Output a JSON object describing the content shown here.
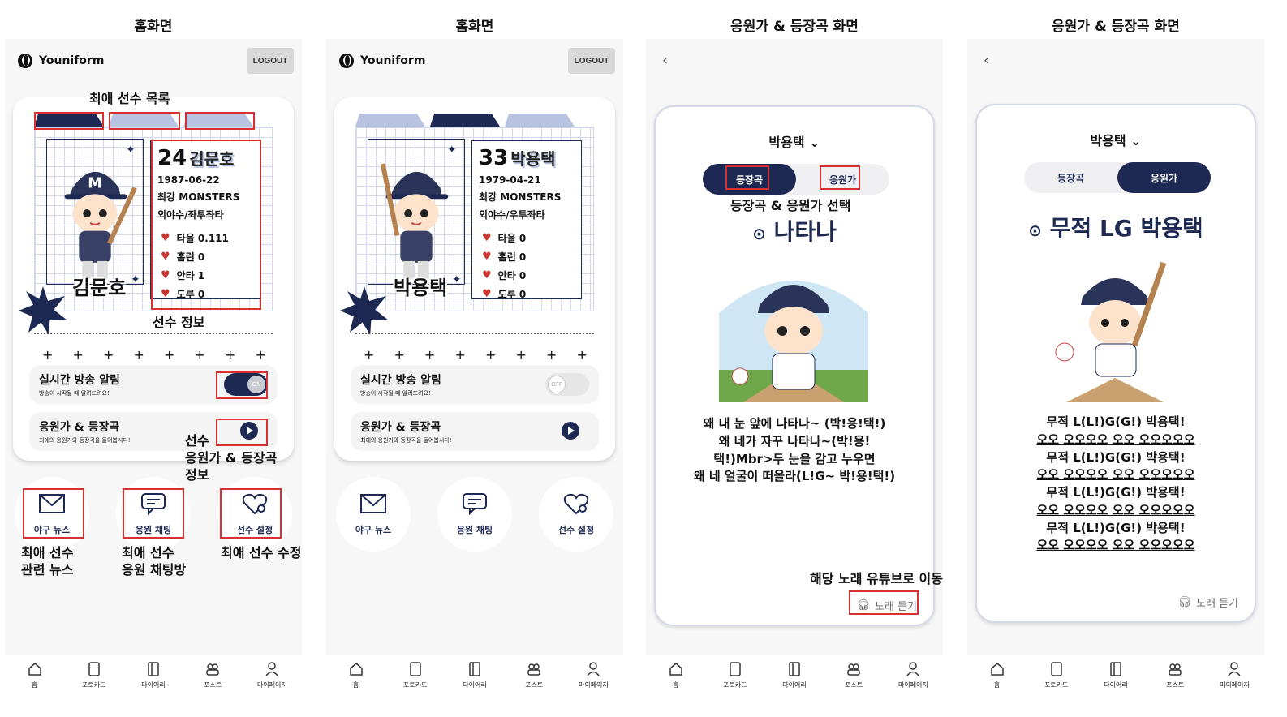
{
  "screens": [
    {
      "caption": "홈화면",
      "brand": "Youniform",
      "logout": "LOGOUT",
      "player": {
        "number": "24",
        "name": "김문호",
        "birth": "1987-06-22",
        "team": "최강 MONSTERS",
        "position": "외야수/좌투좌타",
        "stats": [
          "타율 0.111",
          "홈런 0",
          "안타 1",
          "도루 0"
        ]
      },
      "alert_title": "실시간 방송 알림",
      "alert_sub": "방송이 시작될 때 알려드려요!",
      "toggle": "ON",
      "song_title": "응원가 & 등장곡",
      "song_sub": "최애의 응원가와 등장곡을 들어봅시다!",
      "quick": [
        "야구 뉴스",
        "응원 채팅",
        "선수 설정"
      ]
    },
    {
      "caption": "홈화면",
      "brand": "Youniform",
      "logout": "LOGOUT",
      "player": {
        "number": "33",
        "name": "박용택",
        "birth": "1979-04-21",
        "team": "최강 MONSTERS",
        "position": "외야수/우투좌타",
        "stats": [
          "타율 0",
          "홈런 0",
          "안타 0",
          "도루 0"
        ]
      },
      "alert_title": "실시간 방송 알림",
      "alert_sub": "방송이 시작될 때 알려드려요!",
      "toggle": "OFF",
      "song_title": "응원가 & 등장곡",
      "song_sub": "최애의 응원가와 등장곡을 들어봅시다!",
      "quick": [
        "야구 뉴스",
        "응원 채팅",
        "선수 설정"
      ]
    },
    {
      "caption": "응원가 & 등장곡 화면",
      "back": "‹",
      "selector": "박용택",
      "seg": [
        "등장곡",
        "응원가"
      ],
      "song_title": "나타나",
      "lyrics": [
        "왜 내 눈 앞에 나타나~ (박!용!택!)",
        "왜 네가 자꾸 나타나~(박!용!",
        "택!)Mbr>두 눈을 감고 누우면",
        "왜 네 얼굴이 떠올라(L!G~ 박!용!택!)"
      ],
      "listen": "노래 듣기"
    },
    {
      "caption": "응원가 & 등장곡 화면",
      "back": "‹",
      "selector": "박용택",
      "seg": [
        "등장곡",
        "응원가"
      ],
      "song_title": "무적 LG 박용택",
      "lyrics": [
        "무적 L(L!)G(G!) 박용택!",
        "오오 오오오오 오오 오오오오오",
        "무적 L(L!)G(G!) 박용택!",
        "오오 오오오오 오오 오오오오오",
        "무적 L(L!)G(G!) 박용택!",
        "오오 오오오오 오오 오오오오오",
        "무적 L(L!)G(G!) 박용택!",
        "오오 오오오오 오오 오오오오오"
      ],
      "listen": "노래 듣기"
    }
  ],
  "nav": [
    "홈",
    "포토카드",
    "다이어리",
    "포스트",
    "마이페이지"
  ],
  "annotations": {
    "fav_list": "최애 선수 목록",
    "player_info": "선수 정보",
    "song_info": "선수\n응원가 & 등장곡\n정보",
    "news": "최애 선수\n관련 뉴스",
    "chat": "최애 선수\n응원 채팅방",
    "setting": "최애 선수 수정",
    "select": "등장곡 & 응원가 선택",
    "youtube": "해당 노래 유튜브로 이동"
  },
  "colors": {
    "navy": "#1d2952",
    "accent_red": "#d83030",
    "tab_light": "#b8c3e2"
  }
}
